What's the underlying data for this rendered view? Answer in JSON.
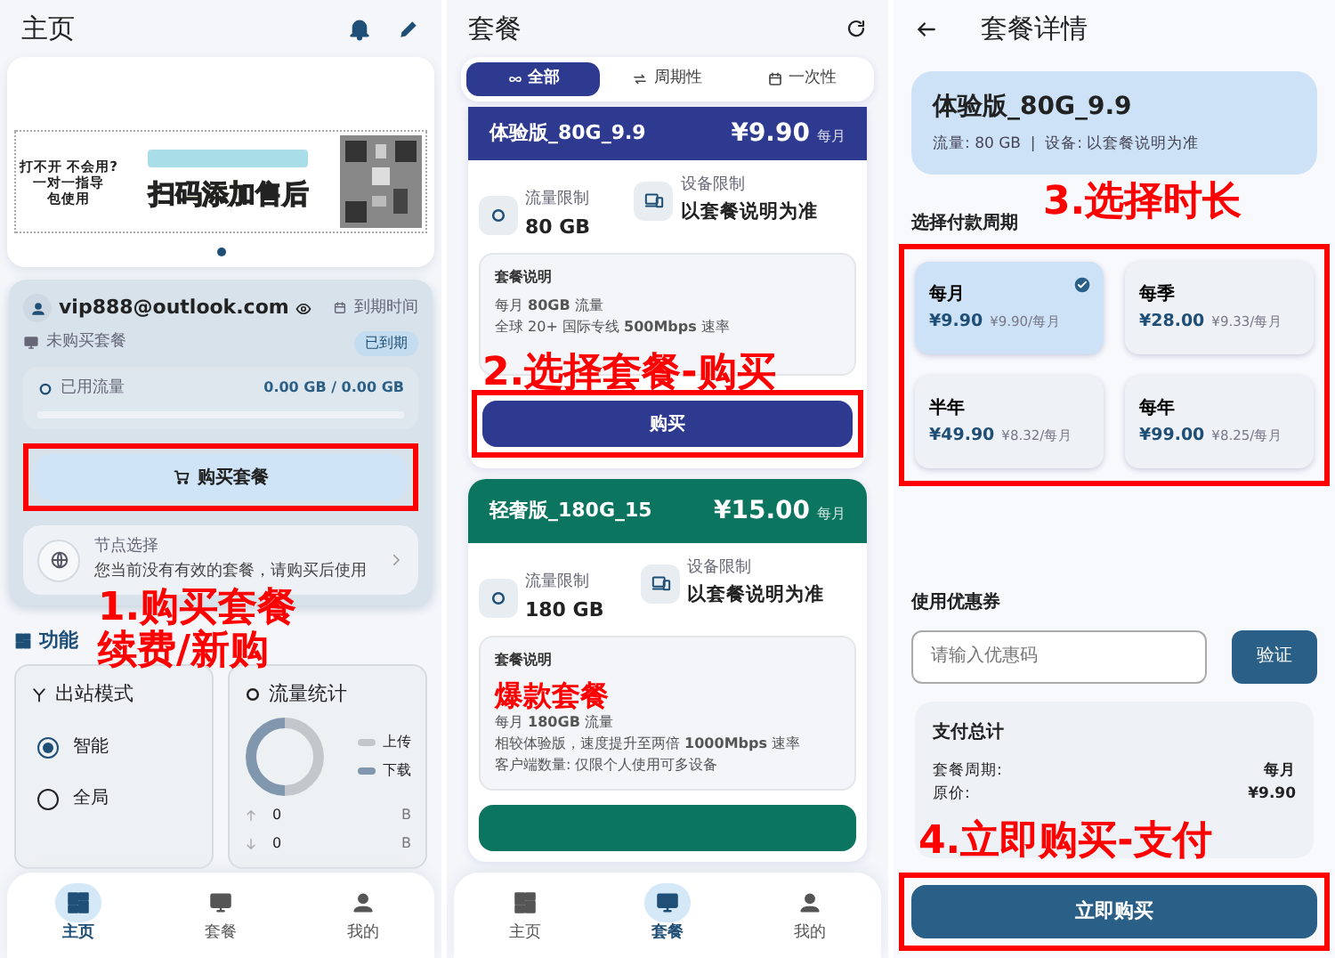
{
  "home": {
    "title": "主页",
    "banner": {
      "lines": [
        "打不开 不会用?",
        "一对一指导",
        "包使用"
      ],
      "headline": "扫码添加售后"
    },
    "account": {
      "email": "vip888@outlook.com",
      "expiry_label": "到期时间",
      "status_badge": "已到期",
      "plan_status": "未购买套餐",
      "traffic_label": "已用流量",
      "traffic_value": "0.00 GB / 0.00 GB",
      "level": 0,
      "buy_button": "购买套餐"
    },
    "node": {
      "label": "节点选择",
      "message": "您当前没有有效的套餐，请购买后使用"
    },
    "section_title": "功能",
    "outbound": {
      "title": "出站模式",
      "options": [
        {
          "label": "智能",
          "selected": true
        },
        {
          "label": "全局",
          "selected": false
        }
      ]
    },
    "stats": {
      "title": "流量统计",
      "legend": [
        {
          "label": "上传",
          "color": "#c3c7cc"
        },
        {
          "label": "下载",
          "color": "#8097ad"
        }
      ],
      "rows": [
        {
          "kind": "up",
          "value": "0",
          "unit": "B"
        },
        {
          "kind": "down",
          "value": "0",
          "unit": "B"
        }
      ]
    },
    "annotation": [
      "1.购买套餐",
      "续费/新购"
    ],
    "nav": [
      {
        "label": "主页",
        "selected": true
      },
      {
        "label": "套餐",
        "selected": false
      },
      {
        "label": "我的",
        "selected": false
      }
    ]
  },
  "plans": {
    "title": "套餐",
    "tabs": [
      {
        "label": "全部",
        "selected": true
      },
      {
        "label": "周期性",
        "selected": false
      },
      {
        "label": "一次性",
        "selected": false
      }
    ],
    "cards": [
      {
        "name": "体验版_80G_9.9",
        "price": "¥9.90",
        "period": "每月",
        "color": "#2e3a8f",
        "traffic_label": "流量限制",
        "traffic": "80 GB",
        "device_label": "设备限制",
        "device": "以套餐说明为准",
        "desc_title": "套餐说明",
        "desc_lines": [
          "每月 **80GB** 流量",
          "全球 20+ 国际专线 **500Mbps** 速率"
        ],
        "button": "购买"
      },
      {
        "name": "轻奢版_180G_15",
        "price": "¥15.00",
        "period": "每月",
        "color": "#0b7560",
        "traffic_label": "流量限制",
        "traffic": "180 GB",
        "device_label": "设备限制",
        "device": "以套餐说明为准",
        "desc_title": "套餐说明",
        "highlight": "爆款套餐",
        "desc_lines": [
          "每月 **180GB** 流量",
          "相较体验版，速度提升至两倍 **1000Mbps** 速率",
          "客户端数量: 仅限个人使用可多设备"
        ]
      }
    ],
    "annotation": "2.选择套餐-购买",
    "nav": [
      {
        "label": "主页",
        "selected": false
      },
      {
        "label": "套餐",
        "selected": true
      },
      {
        "label": "我的",
        "selected": false
      }
    ]
  },
  "detail": {
    "title": "套餐详情",
    "plan": {
      "name": "体验版_80G_9.9",
      "info": "流量: 80 GB  |  设备: 以套餐说明为准"
    },
    "period_title": "选择付款周期",
    "periods": [
      {
        "label": "每月",
        "price": "¥9.90",
        "per": "¥9.90/每月",
        "selected": true
      },
      {
        "label": "每季",
        "price": "¥28.00",
        "per": "¥9.33/每月",
        "selected": false
      },
      {
        "label": "半年",
        "price": "¥49.90",
        "per": "¥8.32/每月",
        "selected": false
      },
      {
        "label": "每年",
        "price": "¥99.00",
        "per": "¥8.25/每月",
        "selected": false
      }
    ],
    "period_annotation": "3.选择时长",
    "coupon": {
      "title": "使用优惠券",
      "placeholder": "请输入优惠码",
      "button": "验证"
    },
    "summary": {
      "title": "支付总计",
      "rows": [
        {
          "label": "套餐周期:",
          "value": "每月"
        },
        {
          "label": "原价:",
          "value": "¥9.90"
        }
      ]
    },
    "buy_annotation": "4.立即购买-支付",
    "buy_button": "立即购买"
  }
}
